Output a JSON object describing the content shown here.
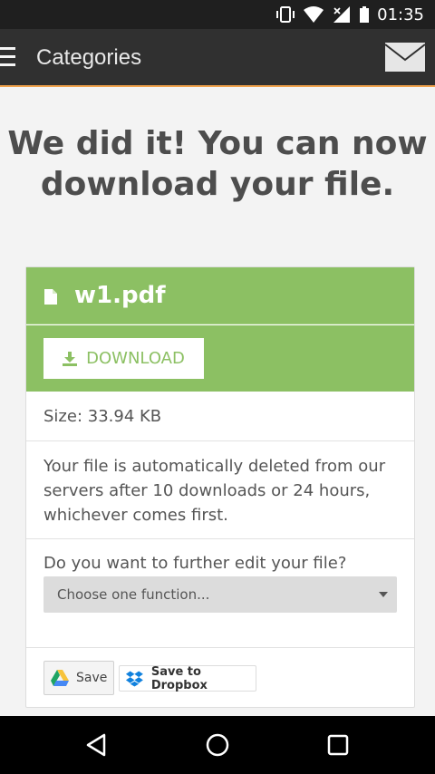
{
  "status_bar": {
    "time": "01:35",
    "icons": [
      "vibrate-icon",
      "wifi-icon",
      "signal-icon",
      "battery-icon"
    ]
  },
  "app_bar": {
    "title": "Categories",
    "icons": [
      "menu-icon",
      "mail-icon"
    ]
  },
  "hero": {
    "line1": "We did it! You can now",
    "line2": "download your file."
  },
  "file_card": {
    "file_name": "w1.pdf",
    "download_label": "DOWNLOAD",
    "size_text": "Size: 33.94 KB",
    "note_text": "Your file is automatically deleted from our servers after 10 downloads or 24 hours, whichever comes first.",
    "edit_question": "Do you want to further edit your file?",
    "function_select": {
      "placeholder": "Choose one function..."
    },
    "save_buttons": {
      "gdrive_label": "Save",
      "dropbox_label": "Save to Dropbox"
    }
  },
  "nav_bar": {
    "buttons": [
      "back-icon",
      "home-icon",
      "recents-icon"
    ]
  },
  "colors": {
    "accent_green": "#8cc063",
    "app_bar": "#303030",
    "app_bar_underline": "#f0a24b",
    "background": "#f3f3f3"
  }
}
